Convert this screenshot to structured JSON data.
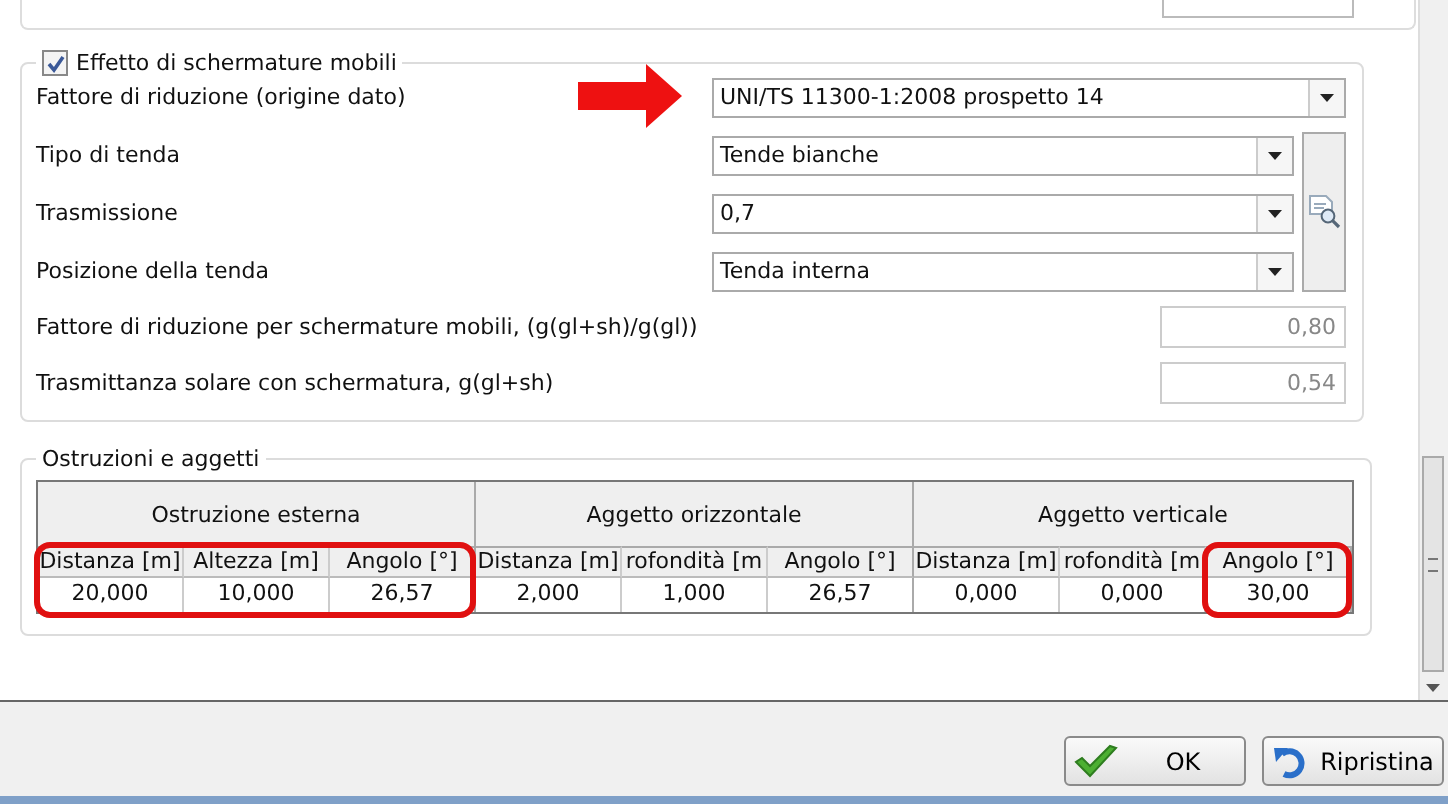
{
  "shading": {
    "title": "Effetto di schermature mobili",
    "checked": true,
    "rows": [
      {
        "kind": "dropdown",
        "label": "Fattore di riduzione (origine dato)",
        "value": "UNI/TS 11300-1:2008 prospetto 14",
        "arrow_pointed": true
      },
      {
        "kind": "dropdown",
        "label": "Tipo di tenda",
        "value": "Tende bianche",
        "arrow_pointed": false
      },
      {
        "kind": "dropdown",
        "label": "Trasmissione",
        "value": "0,7",
        "arrow_pointed": false
      },
      {
        "kind": "dropdown",
        "label": "Posizione della tenda",
        "value": "Tenda interna",
        "arrow_pointed": false
      },
      {
        "kind": "readonly",
        "label": "Fattore di riduzione per schermature mobili, (g(gl+sh)/g(gl))",
        "value": "0,80"
      },
      {
        "kind": "readonly",
        "label": "Trasmittanza solare con schermatura, g(gl+sh)",
        "value": "0,54"
      }
    ]
  },
  "obstructions": {
    "title": "Ostruzioni e aggetti",
    "groups": [
      {
        "title": "Ostruzione esterna",
        "columns": [
          {
            "header": "Distanza [m]",
            "value": "20,000",
            "highlighted": true
          },
          {
            "header": "Altezza [m]",
            "value": "10,000",
            "highlighted": true
          },
          {
            "header": "Angolo [°]",
            "value": "26,57",
            "highlighted": true
          }
        ]
      },
      {
        "title": "Aggetto orizzontale",
        "columns": [
          {
            "header": "Distanza [m]",
            "value": "2,000",
            "highlighted": false
          },
          {
            "header": "rofondità [m",
            "value": "1,000",
            "highlighted": false
          },
          {
            "header": "Angolo [°]",
            "value": "26,57",
            "highlighted": false
          }
        ]
      },
      {
        "title": "Aggetto verticale",
        "columns": [
          {
            "header": "Distanza [m]",
            "value": "0,000",
            "highlighted": false
          },
          {
            "header": "rofondità [m",
            "value": "0,000",
            "highlighted": false
          },
          {
            "header": "Angolo [°]",
            "value": "30,00",
            "highlighted": true
          }
        ]
      }
    ]
  },
  "buttons": [
    {
      "kind": "ok",
      "label": "OK"
    },
    {
      "kind": "reset",
      "label": "Ripristina"
    }
  ]
}
